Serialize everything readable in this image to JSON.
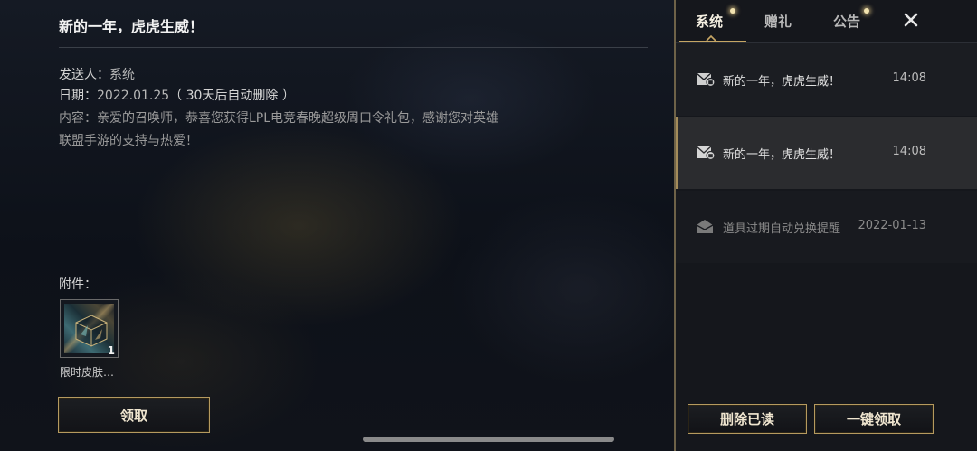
{
  "detail": {
    "title": "新的一年，虎虎生威！",
    "sender_label": "发送人：",
    "sender_value": "系统",
    "date_label": "日期：",
    "date_value": "2022.01.25",
    "date_note": "（ 30天后自动删除 ）",
    "content": "内容：亲爱的召唤师，恭喜您获得LPL电竞春晚超级周口令礼包，感谢您对英雄联盟手游的支持与热爱！",
    "attachments_label": "附件：",
    "attachment": {
      "name": "限时皮肤…",
      "count": "1"
    },
    "claim_label": "领取"
  },
  "panel": {
    "tabs": [
      {
        "label": "系统",
        "active": true,
        "has_dot": true
      },
      {
        "label": "赠礼",
        "active": false,
        "has_dot": false
      },
      {
        "label": "公告",
        "active": false,
        "has_dot": true
      }
    ],
    "close_icon": "close-icon",
    "mails": [
      {
        "subject": "新的一年，虎虎生威！",
        "time": "14:08",
        "icon": "mail-gift-icon",
        "selected": false
      },
      {
        "subject": "新的一年，虎虎生威！",
        "time": "14:08",
        "icon": "mail-gift-icon",
        "selected": true
      },
      {
        "subject": "道具过期自动兑换提醒",
        "time": "2022-01-13",
        "icon": "mail-read-icon",
        "selected": false
      }
    ],
    "delete_read_label": "删除已读",
    "claim_all_label": "一键领取"
  },
  "colors": {
    "gold_accent": "#c6a664",
    "panel_bg": "#15171c",
    "selected_row_bg": "#2b2c2f"
  }
}
